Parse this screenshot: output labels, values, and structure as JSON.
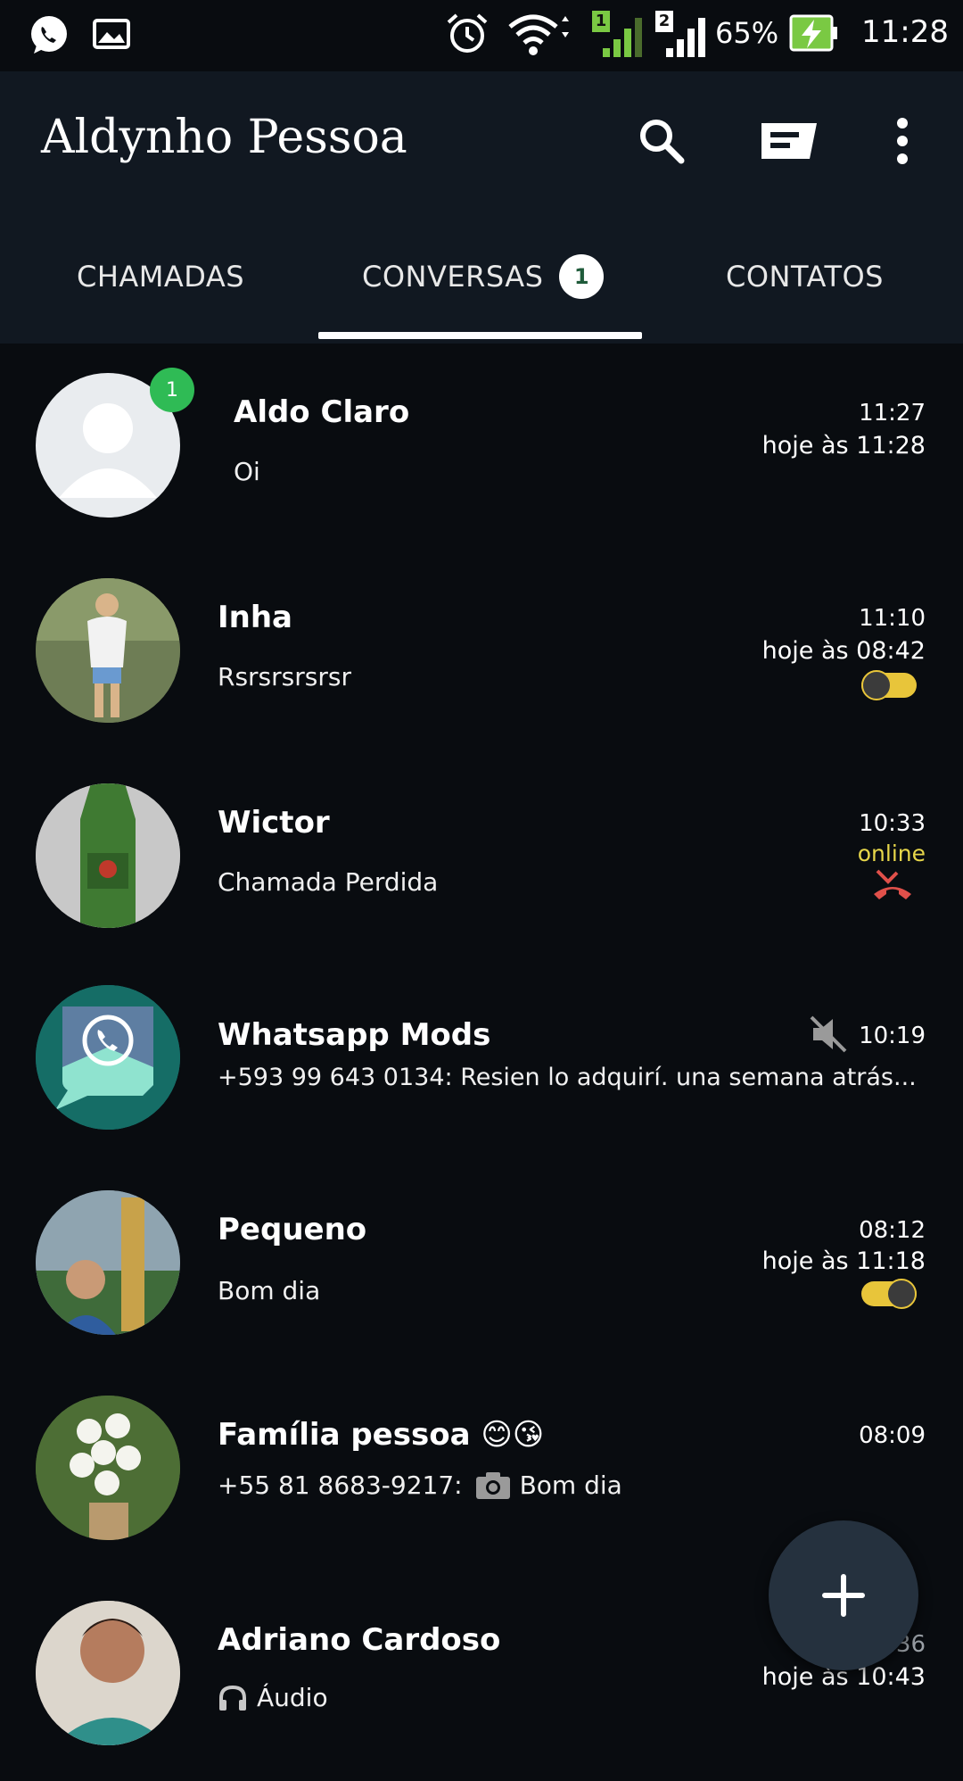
{
  "status_bar": {
    "battery": "65%",
    "time": "11:28",
    "sim1": "1",
    "sim2": "2",
    "icons": [
      "whatsapp-icon",
      "gallery-icon",
      "alarm-icon",
      "wifi-icon",
      "signal-icon",
      "battery-charging-icon"
    ]
  },
  "app_bar": {
    "title": "Aldynho Pessoa",
    "icons": [
      "search-icon",
      "new-message-icon",
      "more-vert-icon"
    ]
  },
  "tabs": [
    {
      "label": "CHAMADAS"
    },
    {
      "label": "CONVERSAS",
      "badge": "1",
      "selected": true
    },
    {
      "label": "CONTATOS"
    }
  ],
  "chats": [
    {
      "name": "Aldo Claro",
      "message": "Oi",
      "time": "11:27",
      "status": "hoje às 11:28",
      "unread": "1"
    },
    {
      "name": "Inha",
      "message": "Rsrsrsrsrsr",
      "time": "11:10",
      "status": "hoje às 08:42"
    },
    {
      "name": "Wictor",
      "message": "Chamada Perdida",
      "time": "10:33",
      "status": "online"
    },
    {
      "name": "Whatsapp Mods",
      "message": "+593 99 643 0134: Resien lo adquirí.  una semana atrás...",
      "time": "10:19",
      "muted": true
    },
    {
      "name": "Pequeno",
      "message": "Bom dia",
      "time": "08:12",
      "status": "hoje às 11:18"
    },
    {
      "name": "Família pessoa 😊😘",
      "message_sender": "+55 81 8683-9217:",
      "message": "Bom dia",
      "time": "08:09"
    },
    {
      "name": "Adriano Cardoso",
      "message": "Áudio",
      "time": "07:36",
      "status": "hoje às 10:43"
    }
  ],
  "colors": {
    "background": "#090c10",
    "app_bar": "#111821",
    "unread_badge": "#2fbb55",
    "toggle_yellow": "#e8c53a",
    "online_yellow": "#e6d64a",
    "missed_call_red": "#e0504a"
  }
}
